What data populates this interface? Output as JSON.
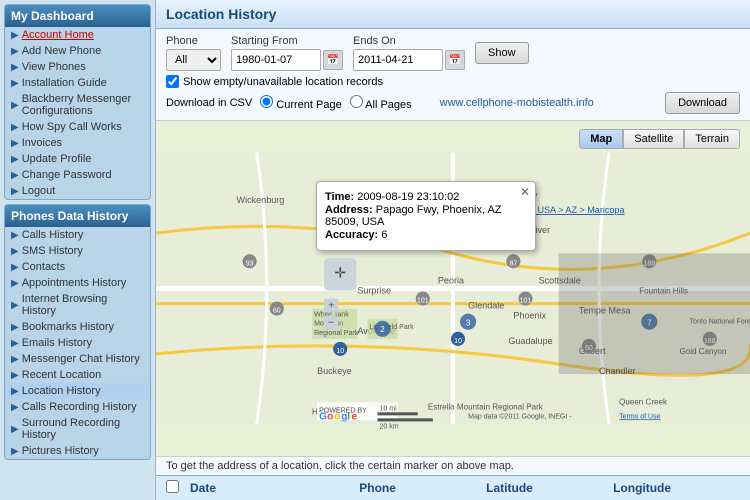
{
  "sidebar": {
    "section1_title": "My Dashboard",
    "section1_items": [
      {
        "label": "Account Home",
        "link": true,
        "bullet": "▶"
      },
      {
        "label": "Add New Phone",
        "link": false,
        "bullet": "▶"
      },
      {
        "label": "View Phones",
        "link": false,
        "bullet": "▶"
      },
      {
        "label": "Installation Guide",
        "link": false,
        "bullet": "▶"
      },
      {
        "label": "Blackberry Messenger Configurations",
        "link": false,
        "bullet": "▶"
      },
      {
        "label": "How Spy Call Works",
        "link": false,
        "bullet": "▶"
      },
      {
        "label": "Invoices",
        "link": false,
        "bullet": "▶"
      },
      {
        "label": "Update Profile",
        "link": false,
        "bullet": "▶"
      },
      {
        "label": "Change Password",
        "link": false,
        "bullet": "▶"
      },
      {
        "label": "Logout",
        "link": false,
        "bullet": "▶"
      }
    ],
    "section2_title": "Phones Data History",
    "section2_items": [
      {
        "label": "Calls History",
        "bullet": "▶"
      },
      {
        "label": "SMS History",
        "bullet": "▶"
      },
      {
        "label": "Contacts",
        "bullet": "▶"
      },
      {
        "label": "Appointments History",
        "bullet": "▶"
      },
      {
        "label": "Internet Browsing History",
        "bullet": "▶"
      },
      {
        "label": "Bookmarks History",
        "bullet": "▶"
      },
      {
        "label": "Emails History",
        "bullet": "▶"
      },
      {
        "label": "Messenger Chat History",
        "bullet": "▶"
      },
      {
        "label": "Recent Location",
        "bullet": "▶"
      },
      {
        "label": "Location History",
        "bullet": "▶",
        "active": true
      },
      {
        "label": "Calls Recording History",
        "bullet": "▶"
      },
      {
        "label": "Surround Recording History",
        "bullet": "▶"
      },
      {
        "label": "Pictures History",
        "bullet": "▶"
      }
    ]
  },
  "main": {
    "title": "Location History",
    "controls": {
      "phone_label": "Phone",
      "phone_value": "All",
      "starting_from_label": "Starting From",
      "starting_from_value": "1980-01-07",
      "ends_on_label": "Ends On",
      "ends_on_value": "2011-04-21",
      "show_button": "Show",
      "checkbox_label": "Show empty/unavailable location records",
      "download_csv_label": "Download in CSV",
      "current_page_label": "Current Page",
      "all_pages_label": "All Pages",
      "website": "www.cellphone-mobistealth.info",
      "download_button": "Download"
    },
    "map": {
      "tab_map": "Map",
      "tab_satellite": "Satellite",
      "tab_terrain": "Terrain",
      "popup": {
        "time_label": "Time:",
        "time_value": "2009-08-19 23:10:02",
        "address_label": "Address:",
        "address_value": "Papago Fwy, Phoenix, AZ 85009, USA",
        "accuracy_label": "Accuracy:",
        "accuracy_value": "6"
      }
    },
    "bottom_text": "To get the address of a location, click the certain marker on above map.",
    "table_headers": [
      "",
      "Date",
      "Phone",
      "Latitude",
      "Longitude"
    ]
  }
}
